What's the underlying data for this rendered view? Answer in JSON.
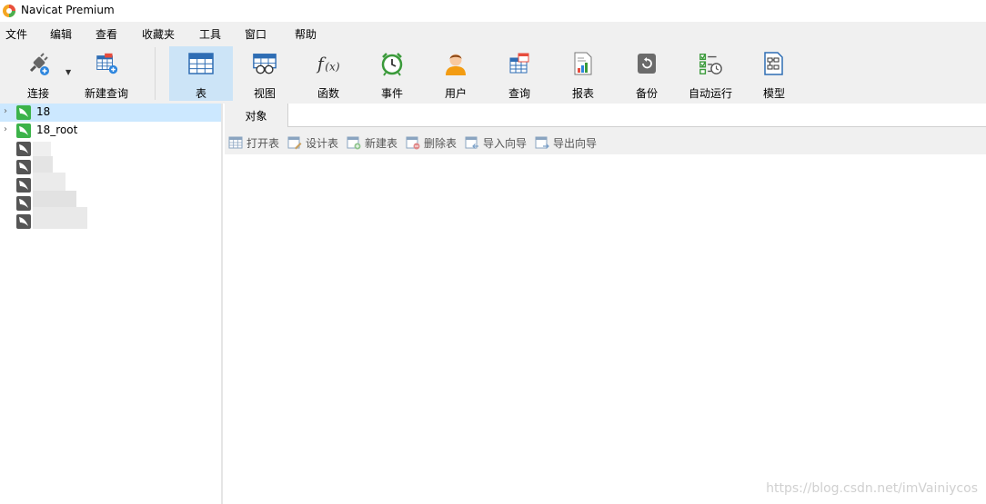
{
  "window": {
    "title": "Navicat Premium"
  },
  "menu": [
    "文件",
    "编辑",
    "查看",
    "收藏夹",
    "工具",
    "窗口",
    "帮助"
  ],
  "toolbar": {
    "connect": "连接",
    "new_query": "新建查询",
    "table": "表",
    "view": "视图",
    "function": "函数",
    "event": "事件",
    "user": "用户",
    "query": "查询",
    "report": "报表",
    "backup": "备份",
    "automation": "自动运行",
    "model": "模型"
  },
  "connections": [
    {
      "label": "18",
      "selected": true
    },
    {
      "label": "18_root",
      "selected": false
    }
  ],
  "tabs": {
    "objects": "对象"
  },
  "object_toolbar": {
    "open_table": "打开表",
    "design_table": "设计表",
    "new_table": "新建表",
    "delete_table": "删除表",
    "import_wizard": "导入向导",
    "export_wizard": "导出向导"
  },
  "watermark": "https://blog.csdn.net/imVainiycos",
  "colors": {
    "active_tool": "#cce4f7",
    "selected_row": "#cce8ff",
    "toolbar_bg": "#f0f0f0",
    "mysql_green": "#3cb34a"
  }
}
